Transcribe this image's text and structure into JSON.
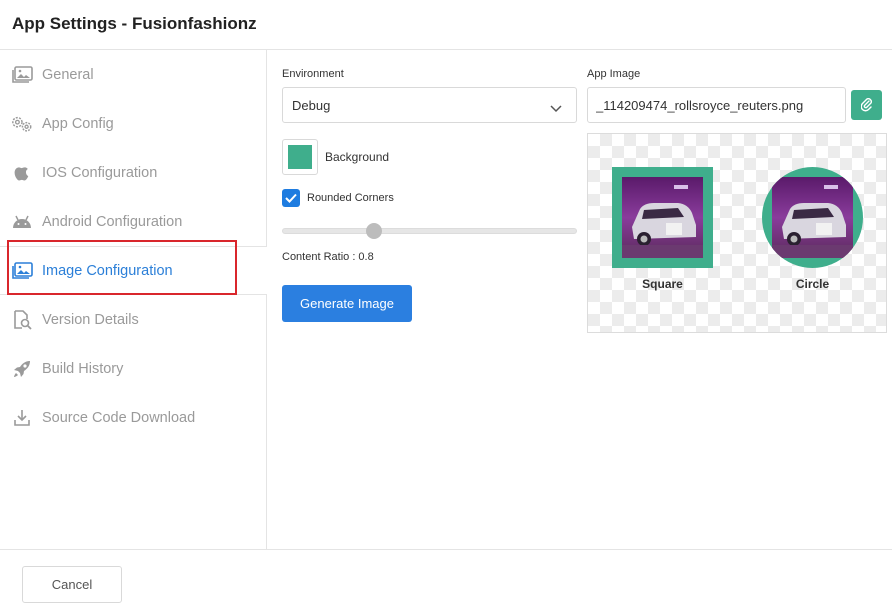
{
  "header": {
    "title": "App Settings - Fusionfashionz"
  },
  "sidebar": {
    "items": [
      {
        "label": "General",
        "icon": "image-gallery-icon"
      },
      {
        "label": "App Config",
        "icon": "gears-icon"
      },
      {
        "label": "IOS Configuration",
        "icon": "apple-icon"
      },
      {
        "label": "Android Configuration",
        "icon": "android-icon"
      },
      {
        "label": "Image Configuration",
        "icon": "image-gallery-icon",
        "active": true
      },
      {
        "label": "Version Details",
        "icon": "document-search-icon"
      },
      {
        "label": "Build History",
        "icon": "rocket-icon"
      },
      {
        "label": "Source Code Download",
        "icon": "download-icon"
      }
    ]
  },
  "form": {
    "environment_label": "Environment",
    "environment_value": "Debug",
    "background_label": "Background",
    "background_color": "#3fae8c",
    "rounded_label": "Rounded Corners",
    "rounded_checked": true,
    "content_ratio": 0.8,
    "content_ratio_label": "Content Ratio : 0.8",
    "generate_label": "Generate Image"
  },
  "app_image": {
    "label": "App Image",
    "filename": "_114209474_rollsroyce_reuters.png",
    "attach_icon": "paperclip-icon"
  },
  "preview": {
    "square_label": "Square",
    "circle_label": "Circle",
    "frame_color": "#3fae8c"
  },
  "footer": {
    "cancel_label": "Cancel"
  },
  "colors": {
    "accent": "#2b7fe0",
    "highlight": "#d9262c",
    "muted_text": "#9a9a9a"
  }
}
